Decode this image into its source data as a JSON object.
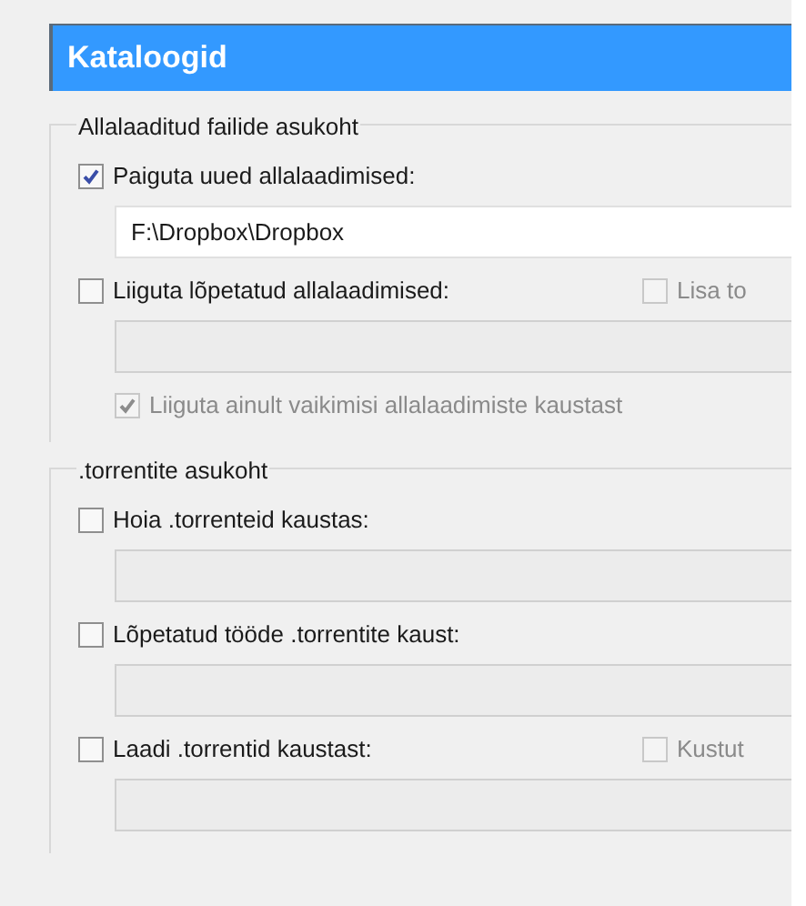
{
  "header": {
    "title": "Kataloogid"
  },
  "groups": [
    {
      "title": "Allalaaditud failide asukoht",
      "rows": [
        {
          "kind": "checkbox",
          "label": "Paiguta uued allalaadimised:",
          "checked": true,
          "disabled": false
        },
        {
          "kind": "field",
          "value": "F:\\Dropbox\\Dropbox",
          "disabled": false
        },
        {
          "kind": "checkbox",
          "label": "Liiguta lõpetatud allalaadimised:",
          "checked": false,
          "disabled": false,
          "side": {
            "label": "Lisa to",
            "checked": false,
            "disabled": true
          }
        },
        {
          "kind": "field",
          "disabled": true
        },
        {
          "kind": "checkbox",
          "label": "Liiguta ainult vaikimisi allalaadimiste kaustast",
          "checked": true,
          "disabled": true,
          "indent": true
        }
      ]
    },
    {
      "title": ".torrentite asukoht",
      "rows": [
        {
          "kind": "checkbox",
          "label": "Hoia .torrenteid kaustas:",
          "checked": false,
          "disabled": false
        },
        {
          "kind": "field",
          "disabled": true
        },
        {
          "kind": "checkbox",
          "label": "Lõpetatud tööde .torrentite kaust:",
          "checked": false,
          "disabled": false
        },
        {
          "kind": "field",
          "disabled": true
        },
        {
          "kind": "checkbox",
          "label": "Laadi .torrentid kaustast:",
          "checked": false,
          "disabled": false,
          "side": {
            "label": "Kustut",
            "checked": false,
            "disabled": true
          }
        },
        {
          "kind": "field",
          "disabled": true
        }
      ]
    }
  ]
}
